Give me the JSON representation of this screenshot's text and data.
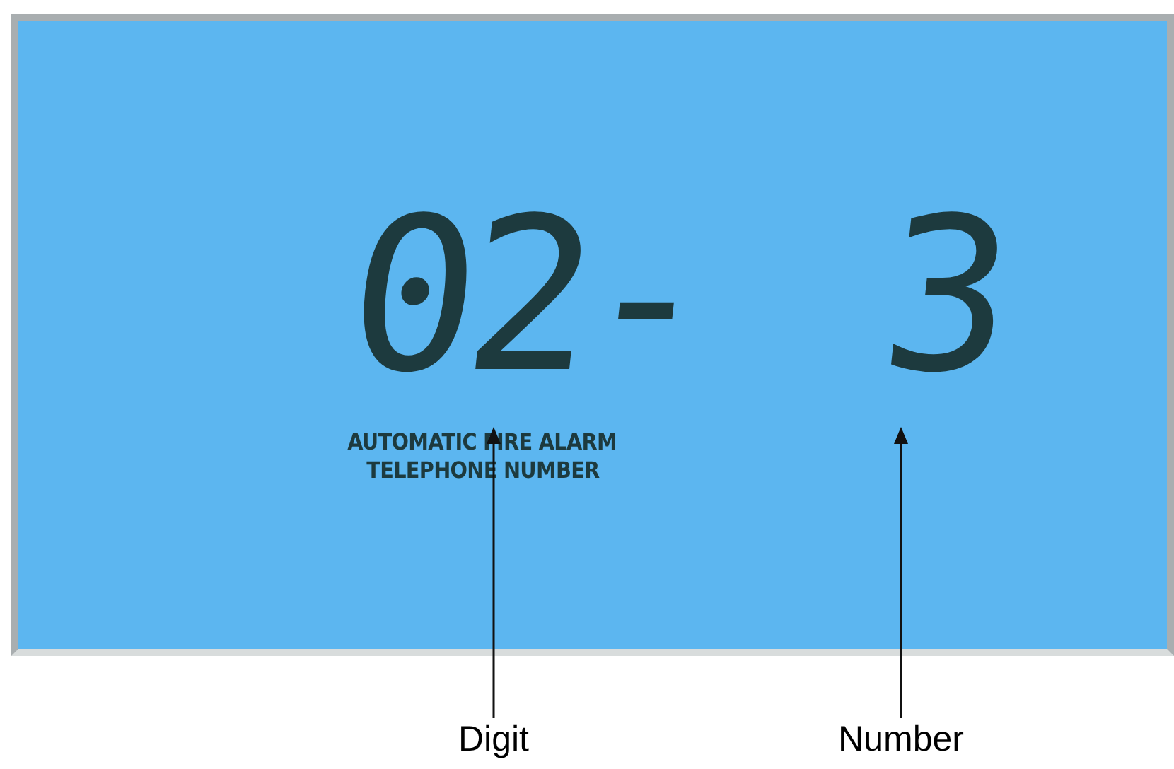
{
  "display": {
    "digits": "02-",
    "number": "3",
    "caption": [
      "AUTOMATIC FIRE ALARM",
      "TELEPHONE NUMBER"
    ]
  },
  "callouts": [
    {
      "label": "Digit"
    },
    {
      "label": "Number"
    }
  ]
}
